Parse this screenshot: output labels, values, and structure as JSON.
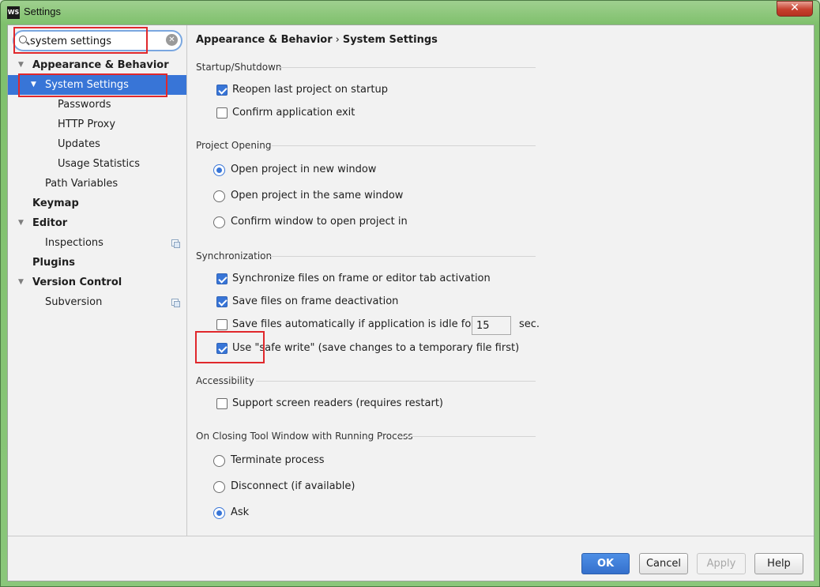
{
  "window": {
    "title": "Settings",
    "app_icon_text": "WS",
    "close_glyph": "✕"
  },
  "search": {
    "value": "system settings",
    "clear_glyph": "✕"
  },
  "tree": [
    {
      "label": "Appearance & Behavior",
      "bold": true,
      "expanded": true,
      "level": 0
    },
    {
      "label": "System Settings",
      "bold": false,
      "expanded": true,
      "level": 1,
      "selected": true
    },
    {
      "label": "Passwords",
      "level": 2
    },
    {
      "label": "HTTP Proxy",
      "level": 2
    },
    {
      "label": "Updates",
      "level": 2
    },
    {
      "label": "Usage Statistics",
      "level": 2
    },
    {
      "label": "Path Variables",
      "level": 1
    },
    {
      "label": "Keymap",
      "bold": true,
      "level": 0
    },
    {
      "label": "Editor",
      "bold": true,
      "expanded": true,
      "level": 0
    },
    {
      "label": "Inspections",
      "level": 1,
      "project_icon": "copy-icon"
    },
    {
      "label": "Plugins",
      "bold": true,
      "level": 0
    },
    {
      "label": "Version Control",
      "bold": true,
      "expanded": true,
      "level": 0
    },
    {
      "label": "Subversion",
      "level": 1,
      "project_icon": "copy-icon"
    }
  ],
  "breadcrumb": {
    "parent": "Appearance & Behavior",
    "separator": "›",
    "current": "System Settings"
  },
  "sections": {
    "startup": {
      "title": "Startup/Shutdown",
      "reopen": {
        "label": "Reopen last project on startup",
        "checked": true
      },
      "confirm_exit": {
        "label": "Confirm application exit",
        "checked": false
      }
    },
    "project_opening": {
      "title": "Project Opening",
      "new_window": {
        "label": "Open project in new window",
        "selected": true
      },
      "same_window": {
        "label": "Open project in the same window",
        "selected": false
      },
      "confirm_window": {
        "label": "Confirm window to open project in",
        "selected": false
      }
    },
    "sync": {
      "title": "Synchronization",
      "sync_files": {
        "label": "Synchronize files on frame or editor tab activation",
        "checked": true
      },
      "save_deactivation": {
        "label": "Save files on frame deactivation",
        "checked": true
      },
      "save_idle": {
        "label": "Save files automatically if application is idle for",
        "checked": false,
        "value": "15",
        "unit": "sec."
      },
      "safe_write": {
        "label": "Use \"safe write\" (save changes to a temporary file first)",
        "checked": true
      }
    },
    "accessibility": {
      "title": "Accessibility",
      "screen_readers": {
        "label": "Support screen readers (requires restart)",
        "checked": false
      }
    },
    "closing": {
      "title": "On Closing Tool Window with Running Process",
      "terminate": {
        "label": "Terminate process",
        "selected": false
      },
      "disconnect": {
        "label": "Disconnect (if available)",
        "selected": false
      },
      "ask": {
        "label": "Ask",
        "selected": true
      }
    }
  },
  "buttons": {
    "ok": "OK",
    "cancel": "Cancel",
    "apply": "Apply",
    "help": "Help"
  },
  "colors": {
    "selection": "#3875d7",
    "highlight": "#e0282c",
    "frame": "#8ac77a"
  }
}
